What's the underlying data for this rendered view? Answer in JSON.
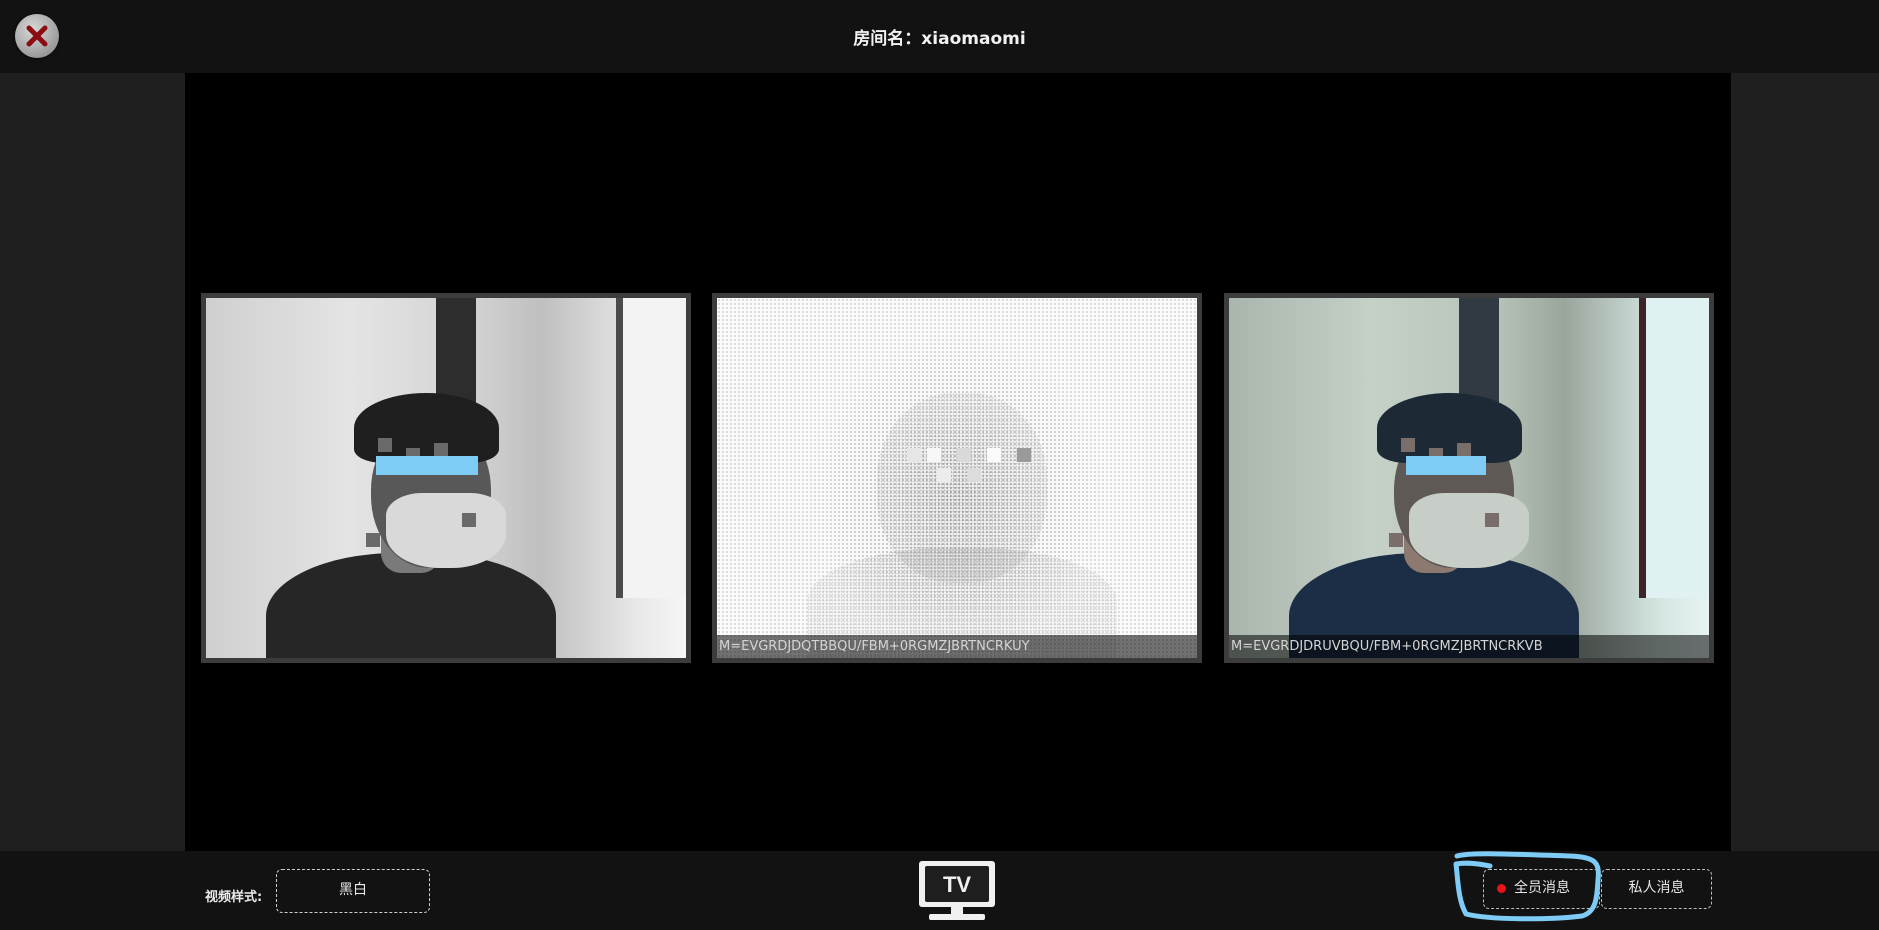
{
  "header": {
    "title": "房间名：xiaomaomi",
    "close_icon": "close-icon"
  },
  "tiles": [
    {
      "caption": "",
      "filter": "grayscale"
    },
    {
      "caption": "M=EVGRDJDQTBBQU/FBM+0RGMZJBRTNCRKUY",
      "filter": "ascii"
    },
    {
      "caption": "M=EVGRDJDRUVBQU/FBM+0RGMZJBRTNCRKVB",
      "filter": "color"
    }
  ],
  "footer": {
    "style_label": "视频样式:",
    "style_value": "黑白",
    "tv_label": "TV",
    "all_messages": "全员消息",
    "private_messages": "私人消息"
  },
  "colors": {
    "accent_dot": "#e8141a",
    "highlight_stroke": "#7ecbf6",
    "close_x": "#8b0d12"
  }
}
